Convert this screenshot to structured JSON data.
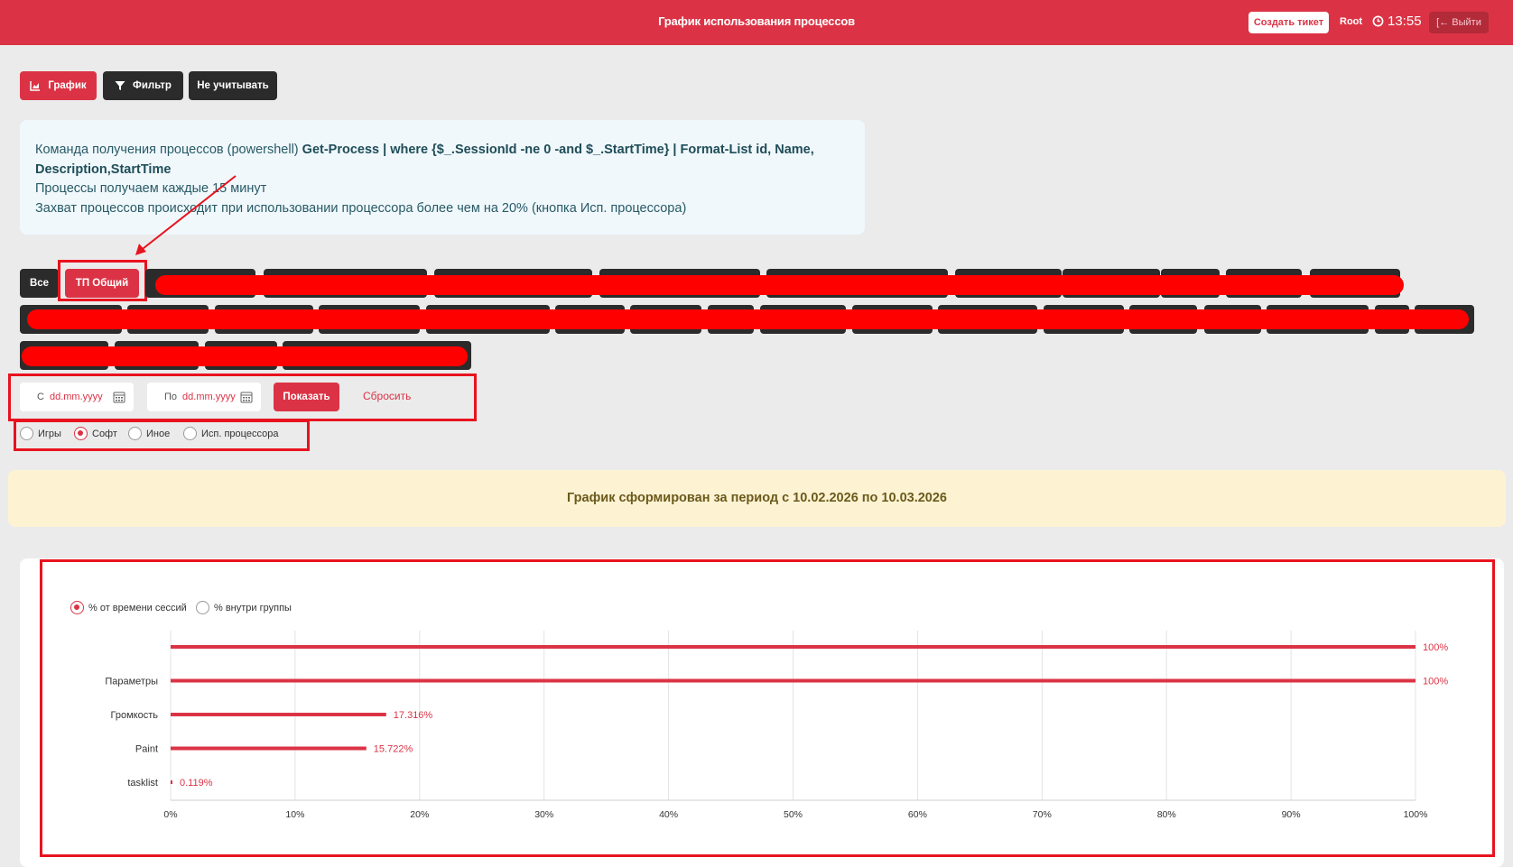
{
  "header": {
    "title": "График использования процессов",
    "ticket_label": "Создать тикет",
    "user": "Root",
    "time": "13:55",
    "logout_label": "Выйти"
  },
  "toolbar": {
    "chart_label": "График",
    "filter_label": "Фильтр",
    "exclude_label": "Не учитывать"
  },
  "info": {
    "cmd_prefix": "Команда получения процессов (powershell) ",
    "cmd": "Get-Process | where {$_.SessionId -ne 0 -and $_.StartTime} | Format-List id, Name, Description,StartTime",
    "interval": "Процессы получаем каждые 15 минут",
    "capture": "Захват процессов происходит при использовании процессора более чем на 20% (кнопка Исп. процессора)"
  },
  "groups": {
    "all_label": "Все",
    "active_label": "ТП Общий"
  },
  "dates": {
    "from_label": "С",
    "to_label": "По",
    "placeholder": "dd.mm.yyyy",
    "show_label": "Показать",
    "reset_label": "Сбросить"
  },
  "categories": [
    {
      "label": "Игры",
      "selected": false
    },
    {
      "label": "Софт",
      "selected": true
    },
    {
      "label": "Иное",
      "selected": false
    },
    {
      "label": "Исп. процессора",
      "selected": false
    }
  ],
  "banner": "График сформирован за период с 10.02.2026 по 10.03.2026",
  "chart_mode": {
    "session_label": "% от времени сессий",
    "group_label": "% внутри группы",
    "selected": "session"
  },
  "chart_data": {
    "type": "bar",
    "orientation": "horizontal",
    "categories": [
      "",
      "Параметры",
      "Громкость",
      "Paint",
      "tasklist"
    ],
    "values": [
      100,
      100,
      17.316,
      15.722,
      0.119
    ],
    "value_labels": [
      "100%",
      "100%",
      "17.316%",
      "15.722%",
      "0.119%"
    ],
    "xlim": [
      0,
      100
    ],
    "xticks": [
      "0%",
      "10%",
      "20%",
      "30%",
      "40%",
      "50%",
      "60%",
      "70%",
      "80%",
      "90%",
      "100%"
    ],
    "grid": true,
    "color": "#db3345"
  },
  "colors": {
    "accent": "#db3345",
    "dark": "#2b2b2b",
    "highlight": "#e8131f"
  }
}
